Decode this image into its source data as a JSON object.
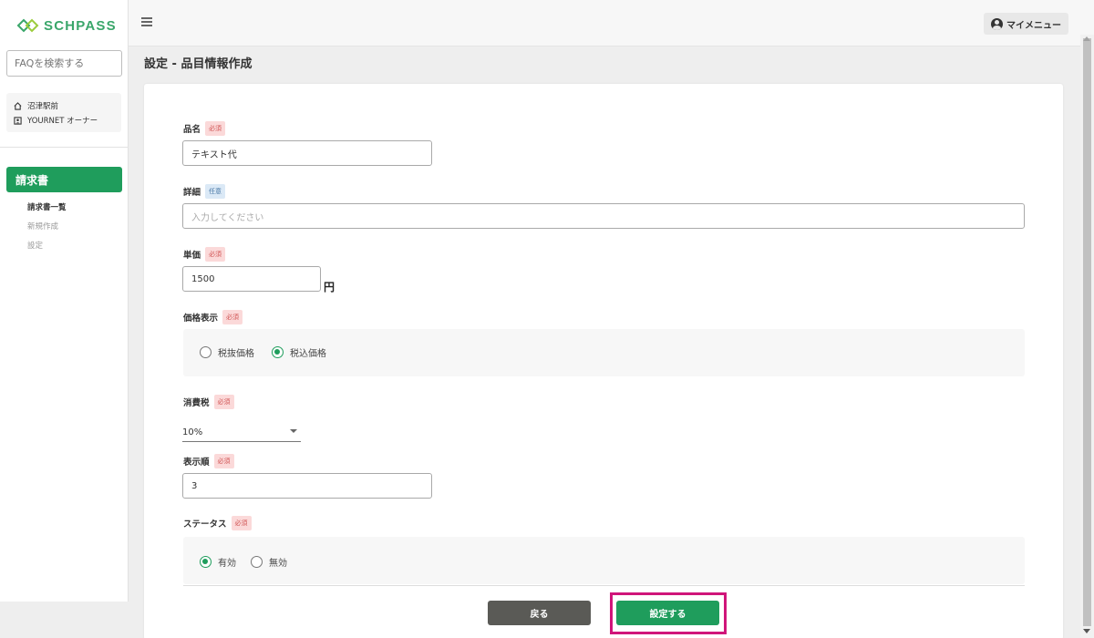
{
  "brand": {
    "name": "SCHPASS"
  },
  "sidebar": {
    "faq_placeholder": "FAQを検索する",
    "org": {
      "location": "沼津駅前",
      "owner": "YOURNET オーナー"
    },
    "nav_main": "請求書",
    "nav_items": [
      {
        "label": "請求書一覧",
        "active": true
      },
      {
        "label": "新規作成",
        "active": false
      },
      {
        "label": "設定",
        "active": false
      }
    ]
  },
  "header": {
    "my_menu": "マイメニュー"
  },
  "page": {
    "title": "設定 - 品目情報作成"
  },
  "form": {
    "required_badge": "必須",
    "optional_badge": "任意",
    "name": {
      "label": "品名",
      "value": "テキスト代"
    },
    "detail": {
      "label": "詳細",
      "placeholder": "入力してください"
    },
    "price": {
      "label": "単価",
      "value": "1500",
      "unit": "円"
    },
    "price_display": {
      "label": "価格表示",
      "options": [
        {
          "label": "税抜価格",
          "selected": false
        },
        {
          "label": "税込価格",
          "selected": true
        }
      ]
    },
    "tax": {
      "label": "消費税",
      "value": "10%"
    },
    "order": {
      "label": "表示順",
      "value": "3"
    },
    "status": {
      "label": "ステータス",
      "options": [
        {
          "label": "有効",
          "selected": true
        },
        {
          "label": "無効",
          "selected": false
        }
      ]
    },
    "back_button": "戻る",
    "submit_button": "設定する"
  },
  "colors": {
    "accent": "#1f9d5c",
    "highlight": "#d0157a",
    "back_button": "#5a5a56"
  }
}
